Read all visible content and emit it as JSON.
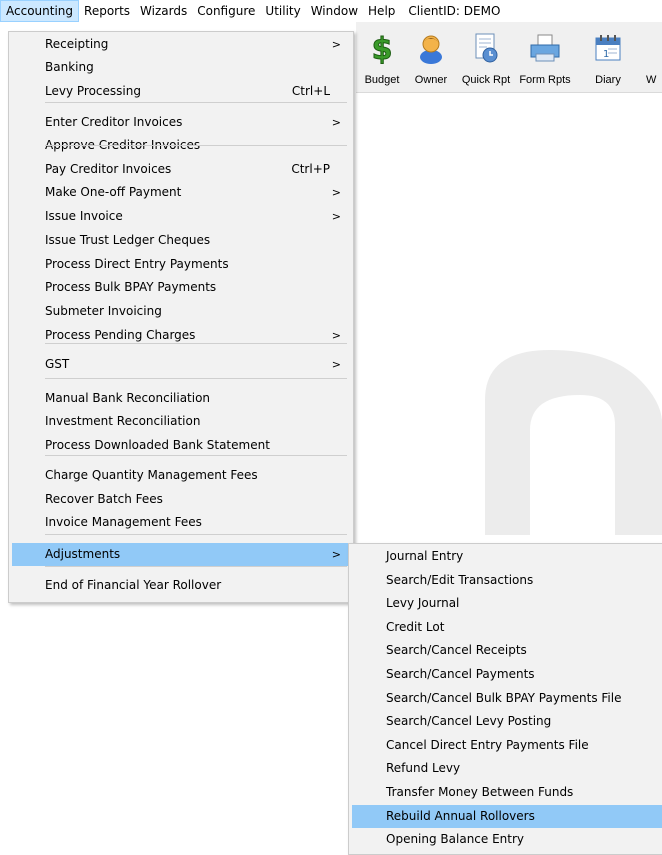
{
  "menubar": {
    "items": [
      "Accounting",
      "Reports",
      "Wizards",
      "Configure",
      "Utility",
      "Window",
      "Help"
    ],
    "client": "ClientID: DEMO"
  },
  "toolbar": {
    "buttons": [
      {
        "label": "Budget",
        "icon": "dollar-icon"
      },
      {
        "label": "Owner",
        "icon": "person-icon"
      },
      {
        "label": "Quick Rpt",
        "icon": "report-clock-icon"
      },
      {
        "label": "Form Rpts",
        "icon": "printer-icon"
      },
      {
        "label": "Diary",
        "icon": "calendar-icon"
      },
      {
        "label": "W",
        "icon": ""
      }
    ]
  },
  "accounting_menu": {
    "items": [
      {
        "label": "Receipting",
        "shortcut": "",
        "submenu": true
      },
      {
        "label": "Banking",
        "shortcut": "",
        "submenu": false
      },
      {
        "label": "Levy Processing",
        "shortcut": "Ctrl+L",
        "submenu": false
      },
      {
        "label": "Enter Creditor Invoices",
        "shortcut": "",
        "submenu": true
      },
      {
        "label": "Approve Creditor Invoices",
        "shortcut": "",
        "submenu": false
      },
      {
        "label": "Pay Creditor Invoices",
        "shortcut": "Ctrl+P",
        "submenu": false
      },
      {
        "label": "Make One-off Payment",
        "shortcut": "",
        "submenu": true
      },
      {
        "label": "Issue Invoice",
        "shortcut": "",
        "submenu": true
      },
      {
        "label": "Issue Trust Ledger Cheques",
        "shortcut": "",
        "submenu": false
      },
      {
        "label": "Process Direct Entry Payments",
        "shortcut": "",
        "submenu": false
      },
      {
        "label": "Process Bulk BPAY Payments",
        "shortcut": "",
        "submenu": false
      },
      {
        "label": "Submeter Invoicing",
        "shortcut": "",
        "submenu": false
      },
      {
        "label": "Process Pending Charges",
        "shortcut": "",
        "submenu": true
      },
      {
        "label": "GST",
        "shortcut": "",
        "submenu": true
      },
      {
        "label": "Manual Bank Reconciliation",
        "shortcut": "",
        "submenu": false
      },
      {
        "label": "Investment Reconciliation",
        "shortcut": "",
        "submenu": false
      },
      {
        "label": "Process Downloaded Bank Statement",
        "shortcut": "",
        "submenu": false
      },
      {
        "label": "Charge Quantity Management Fees",
        "shortcut": "",
        "submenu": false
      },
      {
        "label": "Recover Batch Fees",
        "shortcut": "",
        "submenu": false
      },
      {
        "label": "Invoice Management Fees",
        "shortcut": "",
        "submenu": false
      },
      {
        "label": "Adjustments",
        "shortcut": "",
        "submenu": true
      },
      {
        "label": "End of Financial Year Rollover",
        "shortcut": "",
        "submenu": false
      }
    ],
    "arrow": ">"
  },
  "adjustments_menu": {
    "items": [
      "Journal Entry",
      "Search/Edit Transactions",
      "Levy Journal",
      "Credit Lot",
      "Search/Cancel Receipts",
      "Search/Cancel Payments",
      "Search/Cancel Bulk BPAY Payments File",
      "Search/Cancel Levy Posting",
      "Cancel Direct Entry Payments File",
      "Refund Levy",
      "Transfer Money Between Funds",
      "Rebuild Annual Rollovers",
      "Opening Balance Entry"
    ]
  }
}
